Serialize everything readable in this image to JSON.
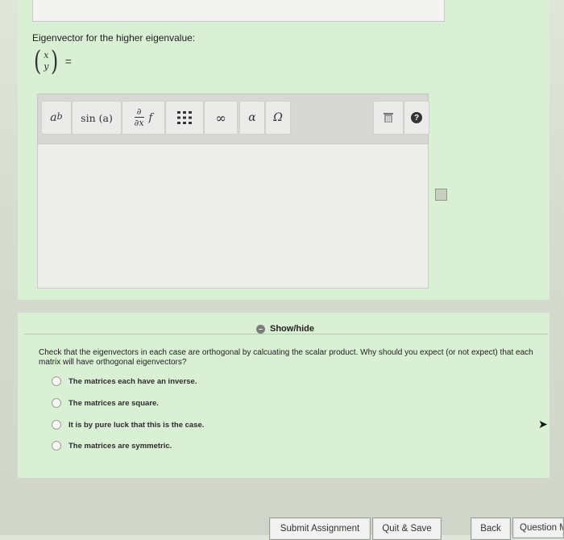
{
  "prompt": "Eigenvector for the higher eigenvalue:",
  "vector": {
    "top": "x",
    "bottom": "y",
    "equals": "="
  },
  "toolbar": {
    "power_base": "a",
    "power_exp": "b",
    "sin": "sin (a)",
    "partial_num": "∂",
    "partial_den": "∂x",
    "partial_f": "f",
    "matrix_icon": "matrix-icon",
    "infinity": "∞",
    "alpha": "α",
    "omega": "Ω",
    "trash_icon": "trash-icon",
    "help": "?"
  },
  "show_hide": "Show/hide",
  "question": "Check that the eigenvectors in each case are orthogonal by calcuating the scalar product. Why should you expect (or not expect) that each matrix will have orthogonal eigenvectors?",
  "options": [
    "The matrices each have an inverse.",
    "The matrices are square.",
    "It is by pure luck that this is the case.",
    "The matrices are symmetric."
  ],
  "footer": {
    "submit": "Submit Assignment",
    "quit_save": "Quit & Save",
    "back": "Back",
    "question_next": "Question M"
  }
}
